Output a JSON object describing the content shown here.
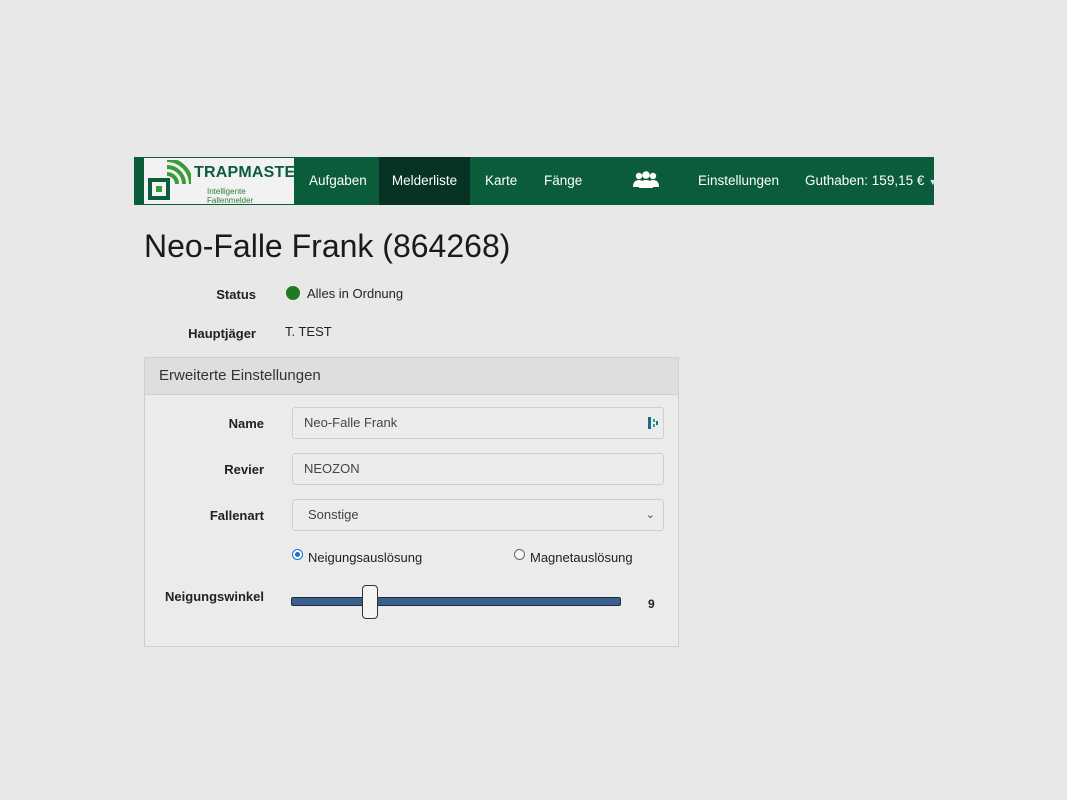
{
  "nav": {
    "brand_title": "TRAPMASTER",
    "brand_subtitle": "Intelligente Fallenmelder",
    "items": [
      {
        "label": "Aufgaben"
      },
      {
        "label": "Melderliste"
      },
      {
        "label": "Karte"
      },
      {
        "label": "Fänge"
      },
      {
        "label": "Einstellungen"
      },
      {
        "label": "Guthaben: 159,15 €"
      }
    ],
    "active_item": "Melderliste",
    "group_icon": "users-icon",
    "colors": {
      "bar": "#0b5c3b",
      "active": "#073324"
    }
  },
  "page": {
    "title": "Neo-Falle Frank (864268)"
  },
  "info": {
    "status_label": "Status",
    "status_value": "Alles in Ordnung",
    "status_color": "#1f7a1f",
    "hunter_label": "Hauptjäger",
    "hunter_value": "T. TEST"
  },
  "panel": {
    "title": "Erweiterte Einstellungen",
    "name_label": "Name",
    "name_value": "Neo-Falle Frank",
    "revier_label": "Revier",
    "revier_value": "NEOZON",
    "fallenart_label": "Fallenart",
    "fallenart_value": "Sonstige",
    "radio_tilt_label": "Neigungsauslösung",
    "radio_magnet_label": "Magnetauslösung",
    "selected_trigger": "Neigungsauslösung",
    "angle_label": "Neigungswinkel",
    "angle_value": "9"
  }
}
